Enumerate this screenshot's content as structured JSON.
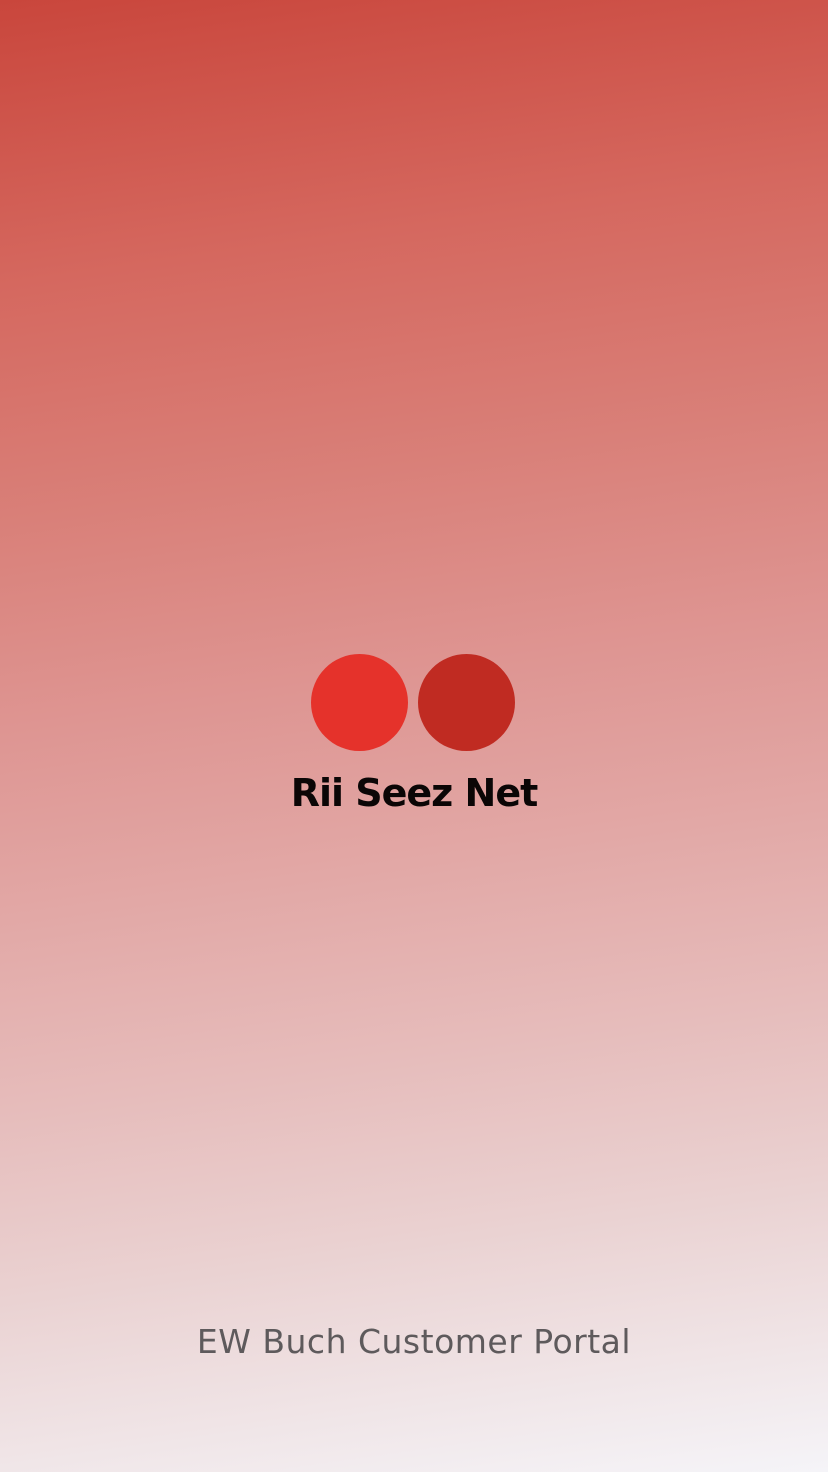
{
  "brand": {
    "name": "Rii Seez Net",
    "dot_left_color": "#e5322b",
    "dot_right_color": "#c02b22",
    "logo_icon": "two-dots-logo-icon"
  },
  "footer": {
    "text": "EW Buch Customer Portal"
  }
}
